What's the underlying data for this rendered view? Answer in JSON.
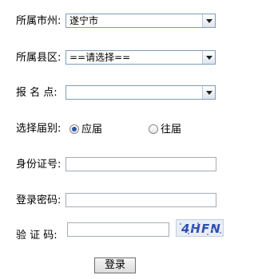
{
  "form": {
    "city": {
      "label": "所属市州:",
      "value": "遂宁市"
    },
    "district": {
      "label": "所属县区:",
      "value": "==请选择=="
    },
    "exam_site": {
      "label": "报 名 点:",
      "value": ""
    },
    "graduation": {
      "label": "选择届别:",
      "options": [
        "应届",
        "往届"
      ],
      "selected": "应届"
    },
    "id_number": {
      "label": "身份证号:",
      "value": ""
    },
    "password": {
      "label": "登录密码:",
      "value": ""
    },
    "captcha": {
      "label": "验 证 码:",
      "value": "",
      "image_text": "4HFN"
    },
    "submit_label": "登录"
  }
}
